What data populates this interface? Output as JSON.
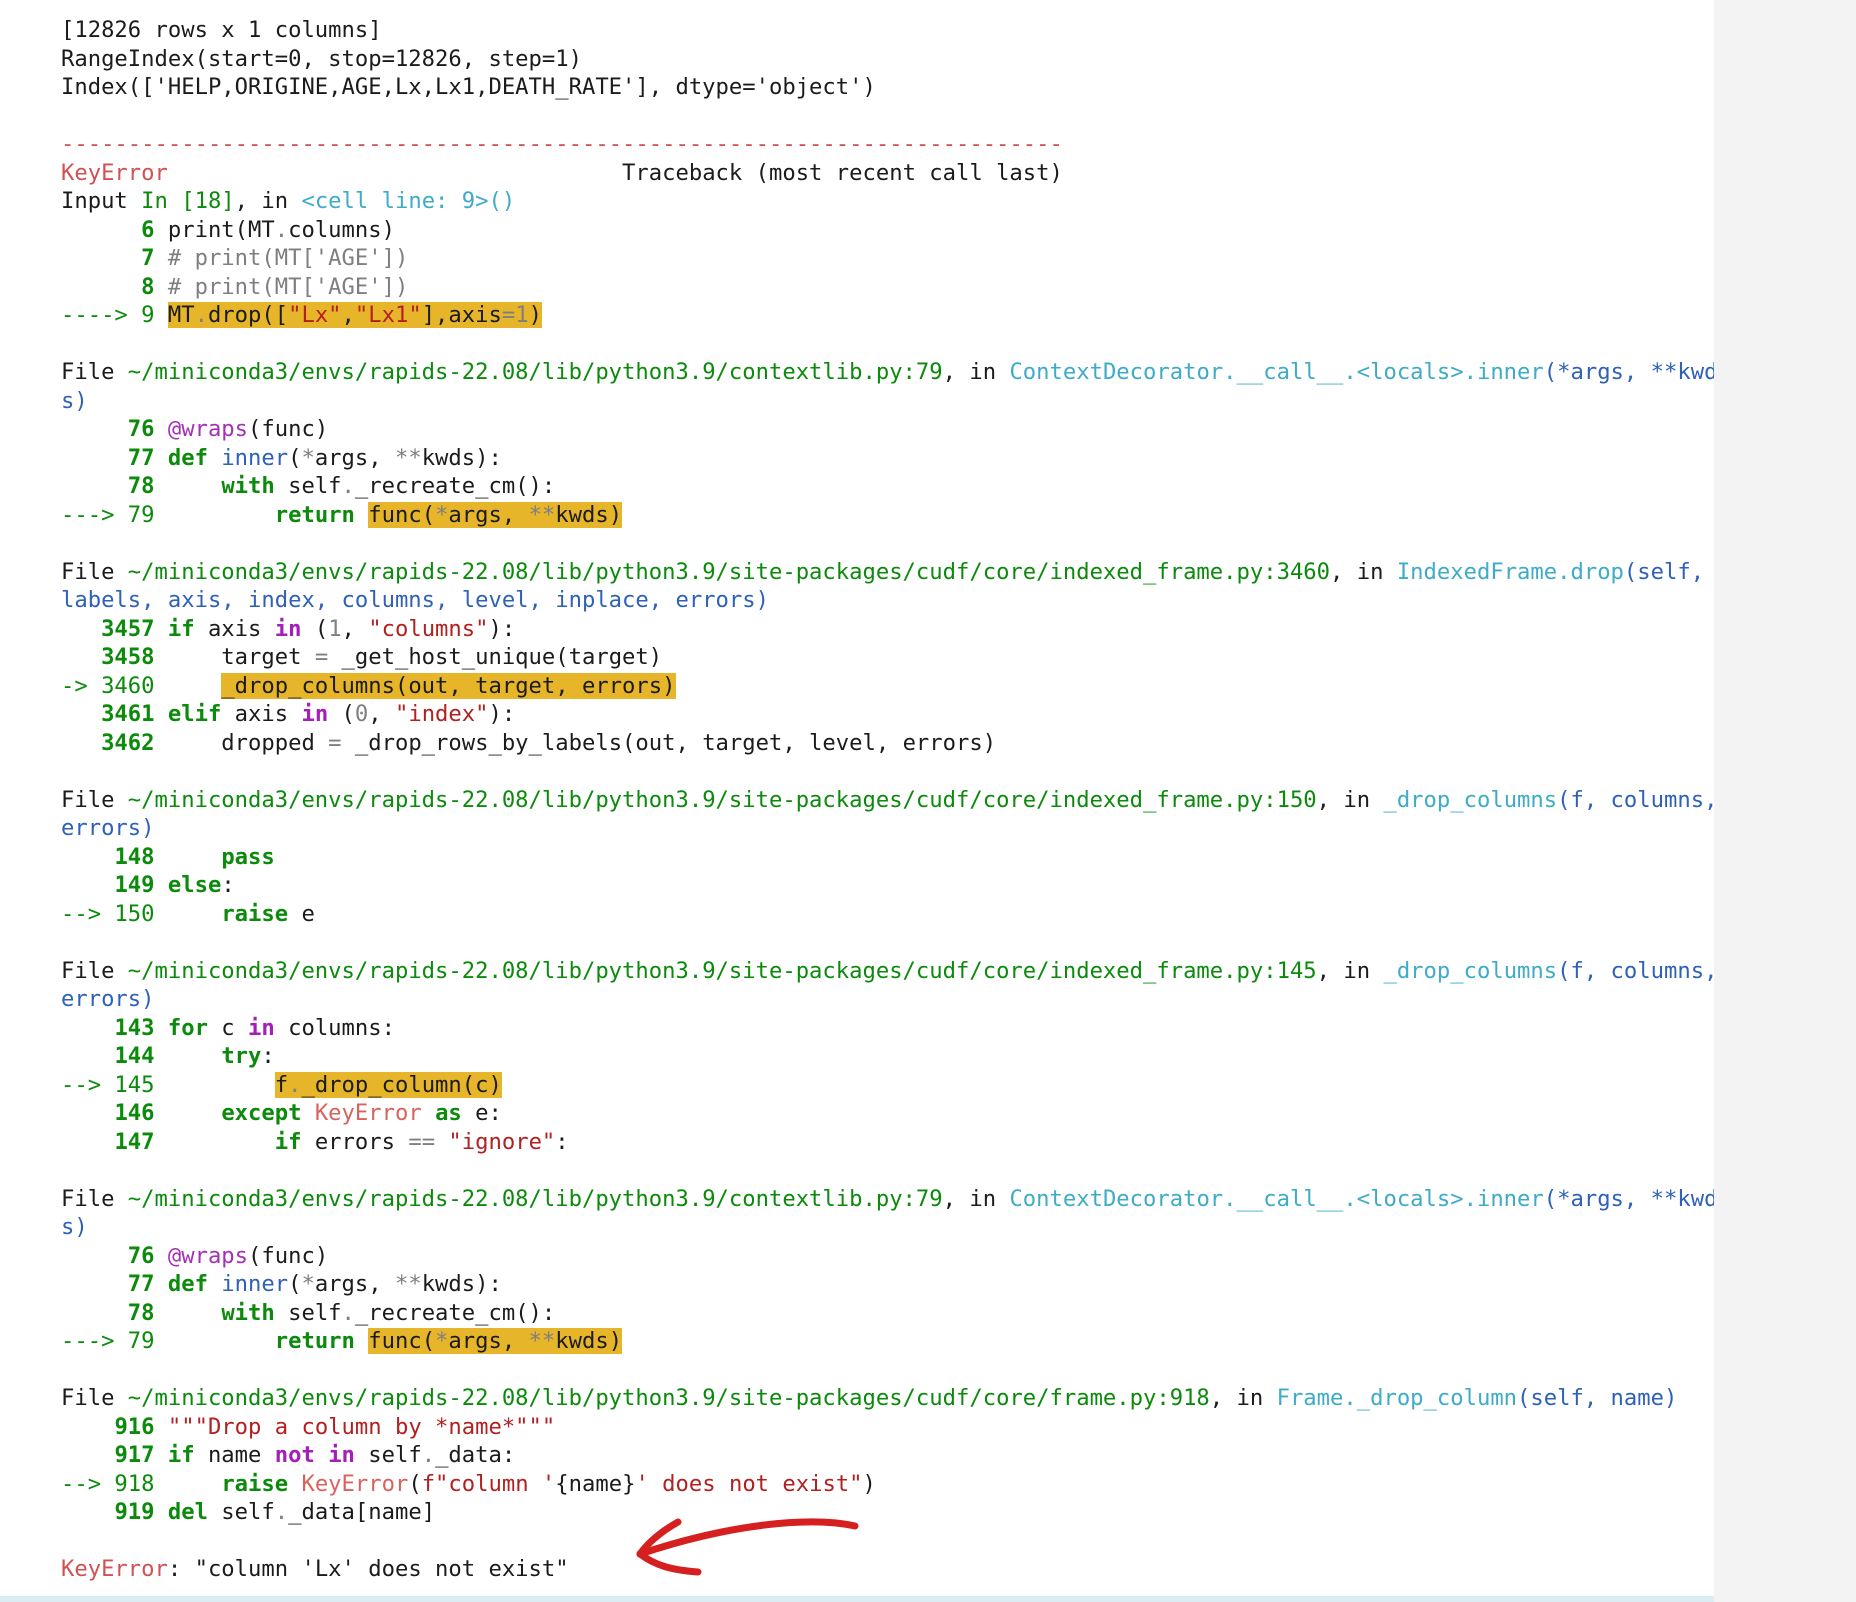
{
  "output": {
    "lines": [
      [
        {
          "t": "[12826 rows x 1 columns]"
        }
      ],
      [
        {
          "t": "RangeIndex(start=0, stop=12826, step=1)"
        }
      ],
      [
        {
          "t": "Index(['HELP,ORIGINE,AGE,Lx,Lx1,DEATH_RATE'], dtype='object')"
        }
      ],
      [
        {
          "t": ""
        }
      ],
      [
        {
          "t": "---------------------------------------------------------------------------",
          "c": "red"
        }
      ],
      [
        {
          "t": "KeyError",
          "c": "red"
        },
        {
          "t": "                                  Traceback (most recent call last)"
        }
      ],
      [
        {
          "t": "Input "
        },
        {
          "t": "In [18]",
          "c": "green"
        },
        {
          "t": ", in "
        },
        {
          "t": "<cell line: 9>()",
          "c": "cyan"
        }
      ],
      [
        {
          "t": "      "
        },
        {
          "t": "6",
          "c": "greenb"
        },
        {
          "t": " print(MT"
        },
        {
          "t": ".",
          "c": "gray"
        },
        {
          "t": "columns)"
        }
      ],
      [
        {
          "t": "      "
        },
        {
          "t": "7",
          "c": "greenb"
        },
        {
          "t": " # print(MT['AGE'])",
          "c": "gray"
        }
      ],
      [
        {
          "t": "      "
        },
        {
          "t": "8",
          "c": "greenb"
        },
        {
          "t": " # print(MT['AGE'])",
          "c": "gray"
        }
      ],
      [
        {
          "t": "----> 9",
          "c": "green"
        },
        {
          "t": " "
        },
        {
          "t": "MT",
          "h": true
        },
        {
          "t": ".",
          "c": "gray",
          "h": true
        },
        {
          "t": "drop([",
          "h": true
        },
        {
          "t": "\"Lx\"",
          "c": "str",
          "h": true
        },
        {
          "t": ",",
          "h": true
        },
        {
          "t": "\"Lx1\"",
          "c": "str",
          "h": true
        },
        {
          "t": "],axis",
          "h": true
        },
        {
          "t": "=",
          "c": "gray",
          "h": true
        },
        {
          "t": "1",
          "c": "gray",
          "h": true
        },
        {
          "t": ")",
          "h": true
        }
      ],
      [
        {
          "t": ""
        }
      ],
      [
        {
          "t": "File "
        },
        {
          "t": "~/miniconda3/envs/rapids-22.08/lib/python3.9/contextlib.py:79",
          "c": "green"
        },
        {
          "t": ", in "
        },
        {
          "t": "ContextDecorator.__call__.<locals>.inner",
          "c": "cyan"
        },
        {
          "t": "(",
          "c": "blue"
        },
        {
          "t": "*args, **kwd",
          "c": "blue"
        }
      ],
      [
        {
          "t": "s)",
          "c": "blue"
        }
      ],
      [
        {
          "t": "     "
        },
        {
          "t": "76",
          "c": "greenb"
        },
        {
          "t": " "
        },
        {
          "t": "@wraps",
          "c": "dec"
        },
        {
          "t": "(func)"
        }
      ],
      [
        {
          "t": "     "
        },
        {
          "t": "77",
          "c": "greenb"
        },
        {
          "t": " "
        },
        {
          "t": "def",
          "c": "kw"
        },
        {
          "t": " "
        },
        {
          "t": "inner",
          "c": "blue"
        },
        {
          "t": "("
        },
        {
          "t": "*",
          "c": "gray"
        },
        {
          "t": "args, "
        },
        {
          "t": "**",
          "c": "gray"
        },
        {
          "t": "kwds):"
        }
      ],
      [
        {
          "t": "     "
        },
        {
          "t": "78",
          "c": "greenb"
        },
        {
          "t": "     "
        },
        {
          "t": "with",
          "c": "kw"
        },
        {
          "t": " self"
        },
        {
          "t": ".",
          "c": "gray"
        },
        {
          "t": "_recreate_cm():"
        }
      ],
      [
        {
          "t": "---> 79",
          "c": "green"
        },
        {
          "t": "         "
        },
        {
          "t": "return",
          "c": "kw"
        },
        {
          "t": " "
        },
        {
          "t": "func(",
          "h": true
        },
        {
          "t": "*",
          "c": "gray",
          "h": true
        },
        {
          "t": "args, ",
          "h": true
        },
        {
          "t": "**",
          "c": "gray",
          "h": true
        },
        {
          "t": "kwds)",
          "h": true
        }
      ],
      [
        {
          "t": ""
        }
      ],
      [
        {
          "t": "File "
        },
        {
          "t": "~/miniconda3/envs/rapids-22.08/lib/python3.9/site-packages/cudf/core/indexed_frame.py:3460",
          "c": "green"
        },
        {
          "t": ", in "
        },
        {
          "t": "IndexedFrame.drop",
          "c": "cyan"
        },
        {
          "t": "(self,",
          "c": "blue"
        }
      ],
      [
        {
          "t": "labels, axis, index, columns, level, inplace, errors)",
          "c": "blue"
        }
      ],
      [
        {
          "t": "   "
        },
        {
          "t": "3457",
          "c": "greenb"
        },
        {
          "t": " "
        },
        {
          "t": "if",
          "c": "kw"
        },
        {
          "t": " axis "
        },
        {
          "t": "in",
          "c": "purple"
        },
        {
          "t": " ("
        },
        {
          "t": "1",
          "c": "gray"
        },
        {
          "t": ", "
        },
        {
          "t": "\"columns\"",
          "c": "str"
        },
        {
          "t": "):"
        }
      ],
      [
        {
          "t": "   "
        },
        {
          "t": "3458",
          "c": "greenb"
        },
        {
          "t": "     target "
        },
        {
          "t": "=",
          "c": "gray"
        },
        {
          "t": " _get_host_unique(target)"
        }
      ],
      [
        {
          "t": "-> 3460",
          "c": "green"
        },
        {
          "t": "     "
        },
        {
          "t": "_drop_columns(out, target, errors)",
          "h": true
        }
      ],
      [
        {
          "t": "   "
        },
        {
          "t": "3461",
          "c": "greenb"
        },
        {
          "t": " "
        },
        {
          "t": "elif",
          "c": "kw"
        },
        {
          "t": " axis "
        },
        {
          "t": "in",
          "c": "purple"
        },
        {
          "t": " ("
        },
        {
          "t": "0",
          "c": "gray"
        },
        {
          "t": ", "
        },
        {
          "t": "\"index\"",
          "c": "str"
        },
        {
          "t": "):"
        }
      ],
      [
        {
          "t": "   "
        },
        {
          "t": "3462",
          "c": "greenb"
        },
        {
          "t": "     dropped "
        },
        {
          "t": "=",
          "c": "gray"
        },
        {
          "t": " _drop_rows_by_labels(out, target, level, errors)"
        }
      ],
      [
        {
          "t": ""
        }
      ],
      [
        {
          "t": "File "
        },
        {
          "t": "~/miniconda3/envs/rapids-22.08/lib/python3.9/site-packages/cudf/core/indexed_frame.py:150",
          "c": "green"
        },
        {
          "t": ", in "
        },
        {
          "t": "_drop_columns",
          "c": "cyan"
        },
        {
          "t": "(f, columns,",
          "c": "blue"
        }
      ],
      [
        {
          "t": "errors)",
          "c": "blue"
        }
      ],
      [
        {
          "t": "    "
        },
        {
          "t": "148",
          "c": "greenb"
        },
        {
          "t": "     "
        },
        {
          "t": "pass",
          "c": "kw"
        }
      ],
      [
        {
          "t": "    "
        },
        {
          "t": "149",
          "c": "greenb"
        },
        {
          "t": " "
        },
        {
          "t": "else",
          "c": "kw"
        },
        {
          "t": ":"
        }
      ],
      [
        {
          "t": "--> 150",
          "c": "green"
        },
        {
          "t": "     "
        },
        {
          "t": "raise",
          "c": "kw"
        },
        {
          "t": " e"
        }
      ],
      [
        {
          "t": ""
        }
      ],
      [
        {
          "t": "File "
        },
        {
          "t": "~/miniconda3/envs/rapids-22.08/lib/python3.9/site-packages/cudf/core/indexed_frame.py:145",
          "c": "green"
        },
        {
          "t": ", in "
        },
        {
          "t": "_drop_columns",
          "c": "cyan"
        },
        {
          "t": "(f, columns,",
          "c": "blue"
        }
      ],
      [
        {
          "t": "errors)",
          "c": "blue"
        }
      ],
      [
        {
          "t": "    "
        },
        {
          "t": "143",
          "c": "greenb"
        },
        {
          "t": " "
        },
        {
          "t": "for",
          "c": "kw"
        },
        {
          "t": " c "
        },
        {
          "t": "in",
          "c": "purple"
        },
        {
          "t": " columns:"
        }
      ],
      [
        {
          "t": "    "
        },
        {
          "t": "144",
          "c": "greenb"
        },
        {
          "t": "     "
        },
        {
          "t": "try",
          "c": "kw"
        },
        {
          "t": ":"
        }
      ],
      [
        {
          "t": "--> 145",
          "c": "green"
        },
        {
          "t": "         "
        },
        {
          "t": "f",
          "h": true
        },
        {
          "t": ".",
          "c": "gray",
          "h": true
        },
        {
          "t": "_drop_column(c)",
          "h": true
        }
      ],
      [
        {
          "t": "    "
        },
        {
          "t": "146",
          "c": "greenb"
        },
        {
          "t": "     "
        },
        {
          "t": "except",
          "c": "kw"
        },
        {
          "t": " "
        },
        {
          "t": "KeyError",
          "c": "err"
        },
        {
          "t": " "
        },
        {
          "t": "as",
          "c": "kw"
        },
        {
          "t": " e:"
        }
      ],
      [
        {
          "t": "    "
        },
        {
          "t": "147",
          "c": "greenb"
        },
        {
          "t": "         "
        },
        {
          "t": "if",
          "c": "kw"
        },
        {
          "t": " errors "
        },
        {
          "t": "==",
          "c": "gray"
        },
        {
          "t": " "
        },
        {
          "t": "\"ignore\"",
          "c": "str"
        },
        {
          "t": ":"
        }
      ],
      [
        {
          "t": ""
        }
      ],
      [
        {
          "t": "File "
        },
        {
          "t": "~/miniconda3/envs/rapids-22.08/lib/python3.9/contextlib.py:79",
          "c": "green"
        },
        {
          "t": ", in "
        },
        {
          "t": "ContextDecorator.__call__.<locals>.inner",
          "c": "cyan"
        },
        {
          "t": "(",
          "c": "blue"
        },
        {
          "t": "*args, **kwd",
          "c": "blue"
        }
      ],
      [
        {
          "t": "s)",
          "c": "blue"
        }
      ],
      [
        {
          "t": "     "
        },
        {
          "t": "76",
          "c": "greenb"
        },
        {
          "t": " "
        },
        {
          "t": "@wraps",
          "c": "dec"
        },
        {
          "t": "(func)"
        }
      ],
      [
        {
          "t": "     "
        },
        {
          "t": "77",
          "c": "greenb"
        },
        {
          "t": " "
        },
        {
          "t": "def",
          "c": "kw"
        },
        {
          "t": " "
        },
        {
          "t": "inner",
          "c": "blue"
        },
        {
          "t": "("
        },
        {
          "t": "*",
          "c": "gray"
        },
        {
          "t": "args, "
        },
        {
          "t": "**",
          "c": "gray"
        },
        {
          "t": "kwds):"
        }
      ],
      [
        {
          "t": "     "
        },
        {
          "t": "78",
          "c": "greenb"
        },
        {
          "t": "     "
        },
        {
          "t": "with",
          "c": "kw"
        },
        {
          "t": " self"
        },
        {
          "t": ".",
          "c": "gray"
        },
        {
          "t": "_recreate_cm():"
        }
      ],
      [
        {
          "t": "---> 79",
          "c": "green"
        },
        {
          "t": "         "
        },
        {
          "t": "return",
          "c": "kw"
        },
        {
          "t": " "
        },
        {
          "t": "func(",
          "h": true
        },
        {
          "t": "*",
          "c": "gray",
          "h": true
        },
        {
          "t": "args, ",
          "h": true
        },
        {
          "t": "**",
          "c": "gray",
          "h": true
        },
        {
          "t": "kwds)",
          "h": true
        }
      ],
      [
        {
          "t": ""
        }
      ],
      [
        {
          "t": "File "
        },
        {
          "t": "~/miniconda3/envs/rapids-22.08/lib/python3.9/site-packages/cudf/core/frame.py:918",
          "c": "green"
        },
        {
          "t": ", in "
        },
        {
          "t": "Frame._drop_column",
          "c": "cyan"
        },
        {
          "t": "(self, name)",
          "c": "blue"
        }
      ],
      [
        {
          "t": "    "
        },
        {
          "t": "916",
          "c": "greenb"
        },
        {
          "t": " "
        },
        {
          "t": "\"\"\"Drop a column by *name*\"\"\"",
          "c": "str"
        }
      ],
      [
        {
          "t": "    "
        },
        {
          "t": "917",
          "c": "greenb"
        },
        {
          "t": " "
        },
        {
          "t": "if",
          "c": "kw"
        },
        {
          "t": " name "
        },
        {
          "t": "not",
          "c": "purple"
        },
        {
          "t": " "
        },
        {
          "t": "in",
          "c": "purple"
        },
        {
          "t": " self"
        },
        {
          "t": ".",
          "c": "gray"
        },
        {
          "t": "_data:"
        }
      ],
      [
        {
          "t": "--> 918",
          "c": "green"
        },
        {
          "t": "     "
        },
        {
          "t": "raise",
          "c": "kw"
        },
        {
          "t": " "
        },
        {
          "t": "KeyError",
          "c": "err"
        },
        {
          "t": "("
        },
        {
          "t": "f\"column '",
          "c": "str"
        },
        {
          "t": "{name}",
          "c": "plain"
        },
        {
          "t": "' does not exist\"",
          "c": "str"
        },
        {
          "t": ")"
        }
      ],
      [
        {
          "t": "    "
        },
        {
          "t": "919",
          "c": "greenb"
        },
        {
          "t": " "
        },
        {
          "t": "del",
          "c": "kw"
        },
        {
          "t": " self"
        },
        {
          "t": ".",
          "c": "gray"
        },
        {
          "t": "_data[name]"
        }
      ],
      [
        {
          "t": ""
        }
      ],
      [
        {
          "t": "KeyError",
          "c": "red"
        },
        {
          "t": ": \"column 'Lx' does not exist\""
        }
      ]
    ]
  },
  "colors": {
    "highlight": "#e6b52a",
    "arrow": "#d62020"
  }
}
